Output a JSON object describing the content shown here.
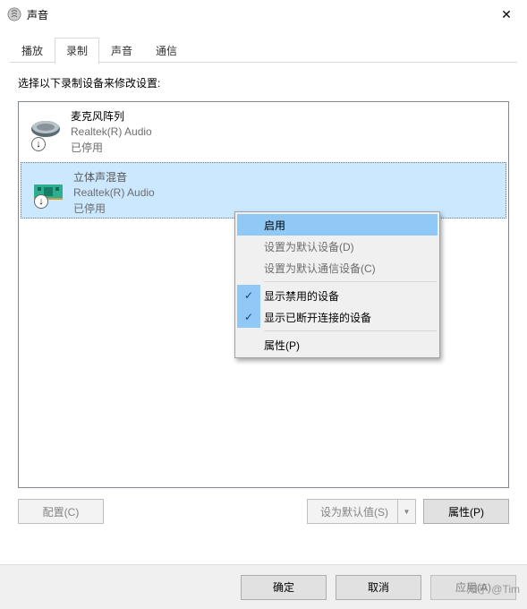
{
  "window": {
    "title": "声音",
    "close_glyph": "✕"
  },
  "tabs": [
    {
      "label": "播放"
    },
    {
      "label": "录制"
    },
    {
      "label": "声音"
    },
    {
      "label": "通信"
    }
  ],
  "active_tab": 1,
  "instruction": "选择以下录制设备来修改设置:",
  "devices": [
    {
      "name": "麦克风阵列",
      "driver": "Realtek(R) Audio",
      "status": "已停用",
      "badge": "↓",
      "icon": "microphone"
    },
    {
      "name": "立体声混音",
      "driver": "Realtek(R) Audio",
      "status": "已停用",
      "badge": "↓",
      "icon": "soundcard"
    }
  ],
  "selected_device": 1,
  "context_menu": {
    "items": [
      {
        "label": "启用",
        "state": "highlight"
      },
      {
        "label": "设置为默认设备(D)",
        "state": "disabled"
      },
      {
        "label": "设置为默认通信设备(C)",
        "state": "disabled"
      },
      {
        "sep": true
      },
      {
        "label": "显示禁用的设备",
        "checked": true
      },
      {
        "label": "显示已断开连接的设备",
        "checked": true
      },
      {
        "sep": true
      },
      {
        "label": "属性(P)"
      }
    ]
  },
  "buttons": {
    "configure": "配置(C)",
    "set_default": "设为默认值(S)",
    "set_default_caret": "▼",
    "properties": "属性(P)",
    "ok": "确定",
    "cancel": "取消",
    "apply": "应用(A)"
  },
  "watermark": "知乎 @Tim"
}
